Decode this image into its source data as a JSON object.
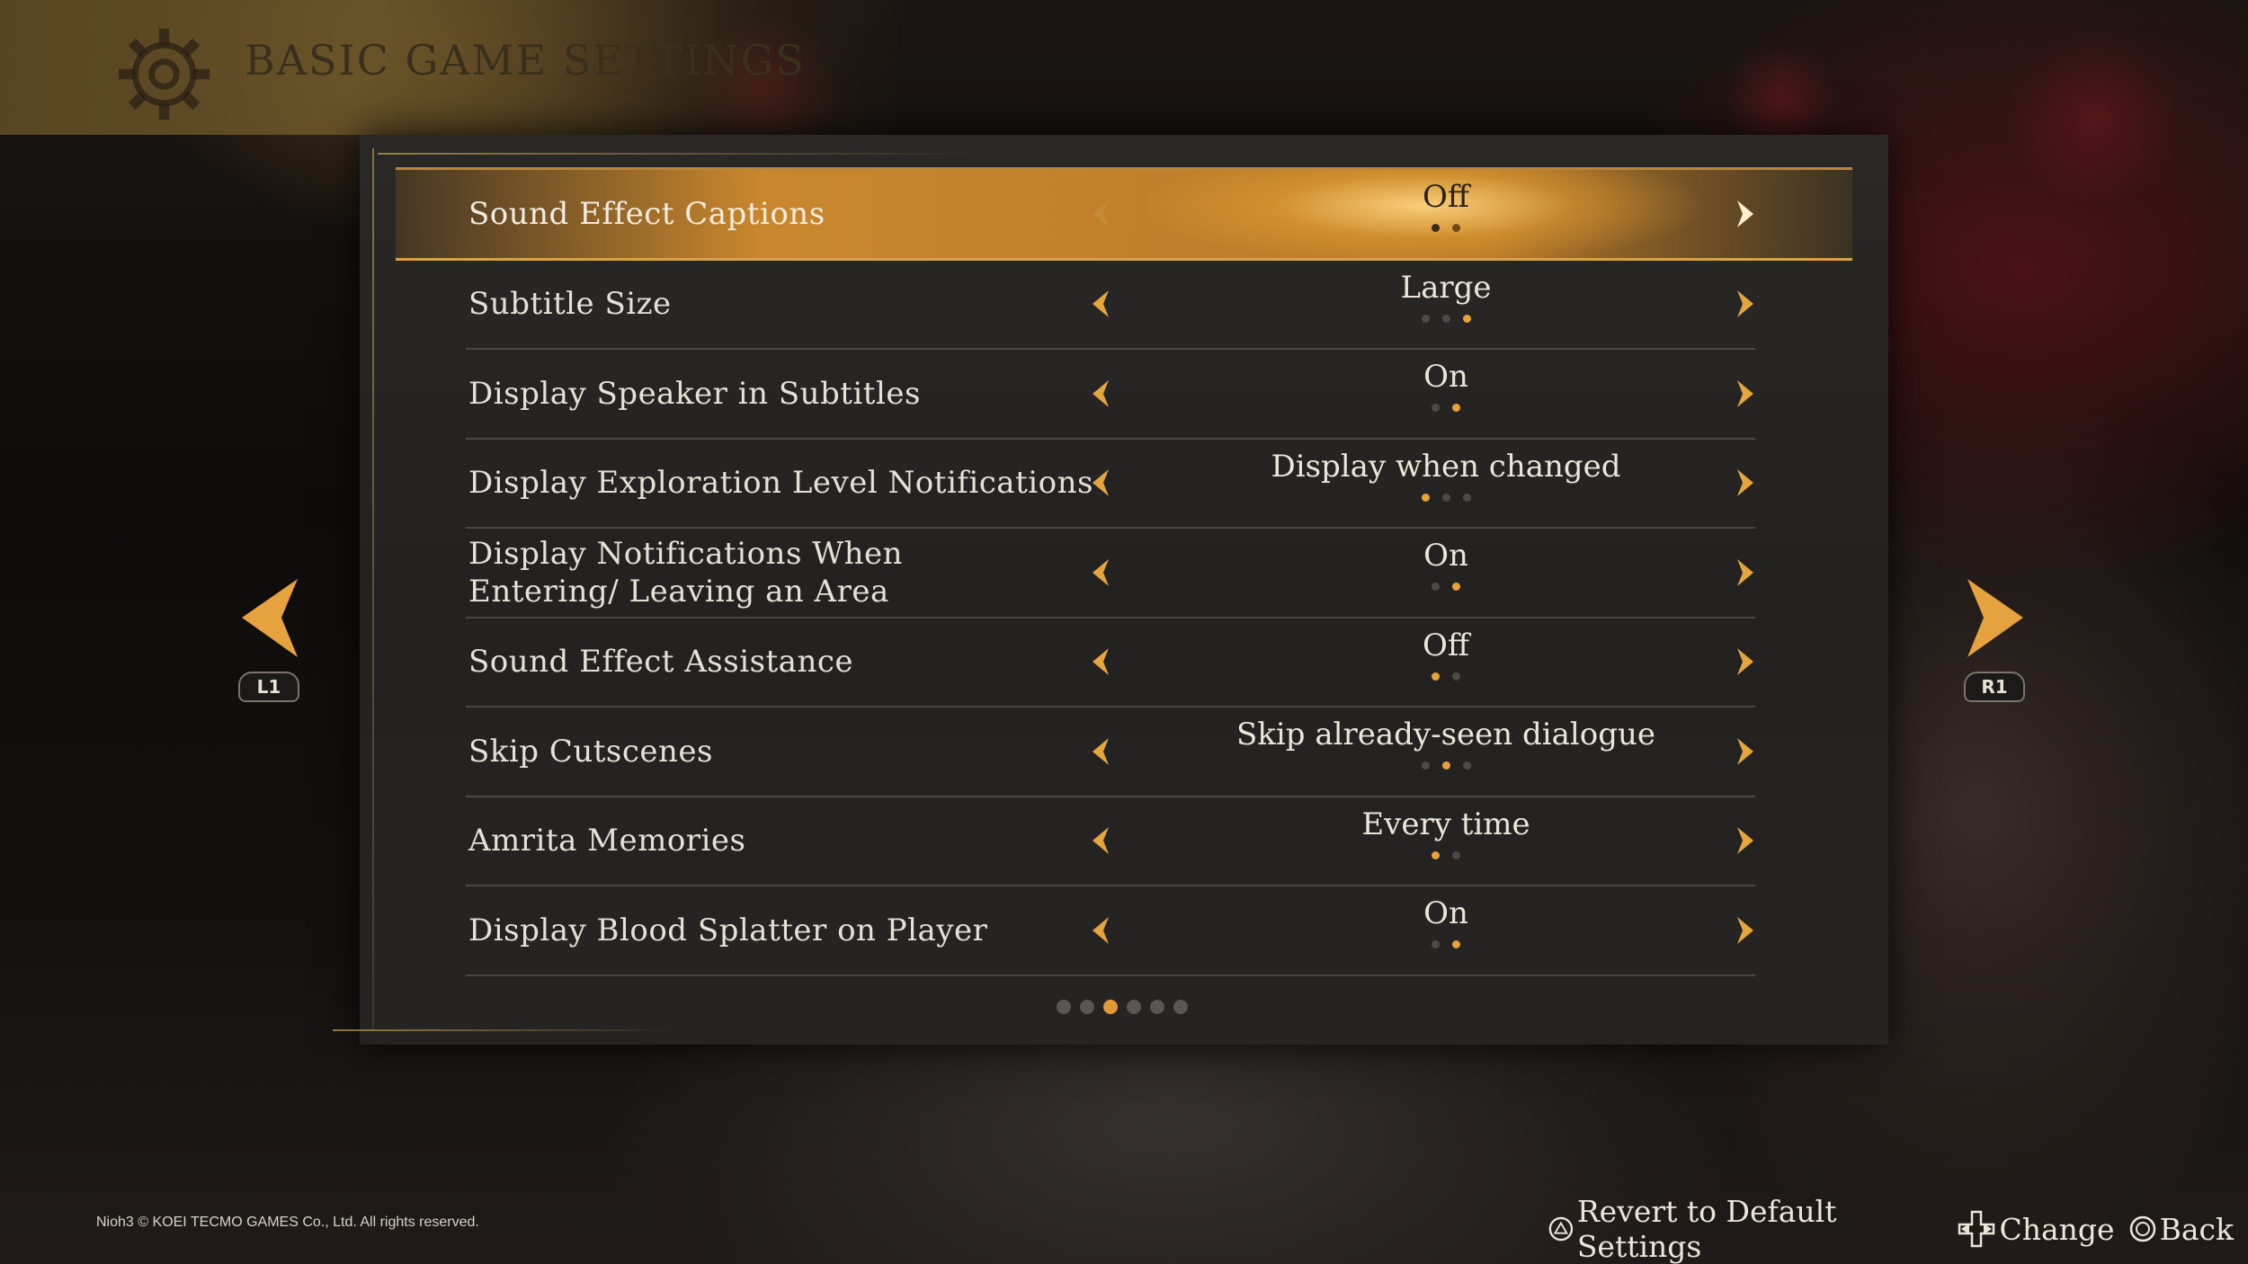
{
  "screen": {
    "title": "BASIC GAME SETTINGS",
    "copyright": "Nioh3 © KOEI TECMO GAMES Co., Ltd. All rights reserved.",
    "page_indicator": {
      "count": 6,
      "current": 3
    }
  },
  "nav": {
    "left_badge": "L1",
    "right_badge": "R1"
  },
  "settings": [
    {
      "label": "Sound Effect Captions",
      "value": "Off",
      "options": 2,
      "selected_option": 1,
      "selected": true
    },
    {
      "label": "Subtitle Size",
      "value": "Large",
      "options": 3,
      "selected_option": 3
    },
    {
      "label": "Display Speaker in Subtitles",
      "value": "On",
      "options": 2,
      "selected_option": 2
    },
    {
      "label": "Display Exploration Level Notifications",
      "value": "Display when changed",
      "options": 3,
      "selected_option": 1
    },
    {
      "label": "Display Notifications When Entering/ Leaving an Area",
      "value": "On",
      "options": 2,
      "selected_option": 2
    },
    {
      "label": "Sound Effect Assistance",
      "value": "Off",
      "options": 2,
      "selected_option": 1
    },
    {
      "label": "Skip Cutscenes",
      "value": "Skip already-seen dialogue",
      "options": 3,
      "selected_option": 2
    },
    {
      "label": "Amrita Memories",
      "value": "Every time",
      "options": 2,
      "selected_option": 1
    },
    {
      "label": "Display Blood Splatter on Player",
      "value": "On",
      "options": 2,
      "selected_option": 2
    }
  ],
  "footer": {
    "revert_label": "Revert to Default Settings",
    "change_label": "Change",
    "back_label": "Back"
  },
  "colors": {
    "accent": "#e4a53f",
    "selected_row": "#d9a24a",
    "panel": "#262422"
  },
  "icons": {
    "title": "gear-icon",
    "revert": "triangle-button-icon",
    "change": "dpad-icon",
    "back": "circle-button-icon"
  }
}
